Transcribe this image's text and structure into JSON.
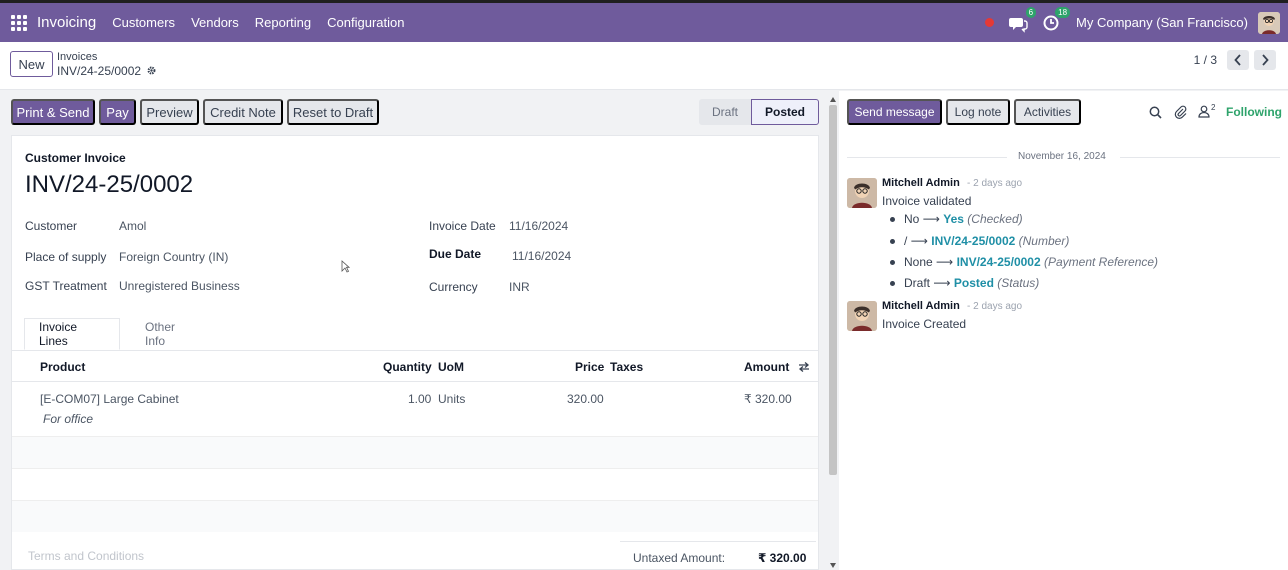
{
  "app": {
    "name": "Invoicing",
    "menu": [
      "Customers",
      "Vendors",
      "Reporting",
      "Configuration"
    ],
    "messages_badge": "6",
    "activities_badge": "18",
    "company": "My Company (San Francisco)"
  },
  "control": {
    "new_label": "New",
    "breadcrumb_parent": "Invoices",
    "breadcrumb_current": "INV/24-25/0002",
    "pager": "1 / 3"
  },
  "actions": {
    "print_send": "Print & Send",
    "pay": "Pay",
    "preview": "Preview",
    "credit_note": "Credit Note",
    "reset_draft": "Reset to Draft"
  },
  "status": {
    "draft": "Draft",
    "posted": "Posted",
    "current": "Posted"
  },
  "invoice": {
    "type": "Customer Invoice",
    "number": "INV/24-25/0002",
    "customer_label": "Customer",
    "customer": "Amol",
    "supply_label": "Place of supply",
    "supply": "Foreign Country (IN)",
    "gst_label": "GST Treatment",
    "gst": "Unregistered Business",
    "date_label": "Invoice Date",
    "date": "11/16/2024",
    "due_label": "Due Date",
    "due": "11/16/2024",
    "currency_label": "Currency",
    "currency": "INR"
  },
  "tabs": [
    "Invoice Lines",
    "Other Info"
  ],
  "lines": {
    "headers": {
      "product": "Product",
      "quantity": "Quantity",
      "uom": "UoM",
      "price": "Price",
      "taxes": "Taxes",
      "amount": "Amount"
    },
    "rows": [
      {
        "product": "[E-COM07] Large Cabinet",
        "description": "For office",
        "quantity": "1.00",
        "uom": "Units",
        "price": "320.00",
        "taxes": "",
        "amount": "₹ 320.00"
      }
    ]
  },
  "footer": {
    "terms_placeholder": "Terms and Conditions",
    "untaxed_label": "Untaxed Amount:",
    "untaxed_value": "₹ 320.00"
  },
  "chatter": {
    "send_message": "Send message",
    "log_note": "Log note",
    "activities": "Activities",
    "followers_count": "2",
    "following": "Following",
    "date": "November 16, 2024",
    "messages": [
      {
        "author": "Mitchell Admin",
        "ago": "- 2 days ago",
        "body": "Invoice validated",
        "changes": [
          {
            "old": "No",
            "new": "Yes",
            "field": "(Checked)"
          },
          {
            "old": "/",
            "new": "INV/24-25/0002",
            "field": "(Number)"
          },
          {
            "old": "None",
            "new": "INV/24-25/0002",
            "field": "(Payment Reference)"
          },
          {
            "old": "Draft",
            "new": "Posted",
            "field": "(Status)"
          }
        ]
      },
      {
        "author": "Mitchell Admin",
        "ago": "- 2 days ago",
        "body": "Invoice Created",
        "changes": []
      }
    ]
  },
  "colors": {
    "brand": "#6f5b9c",
    "link": "#1f8fa6",
    "following": "#2ea36b"
  }
}
